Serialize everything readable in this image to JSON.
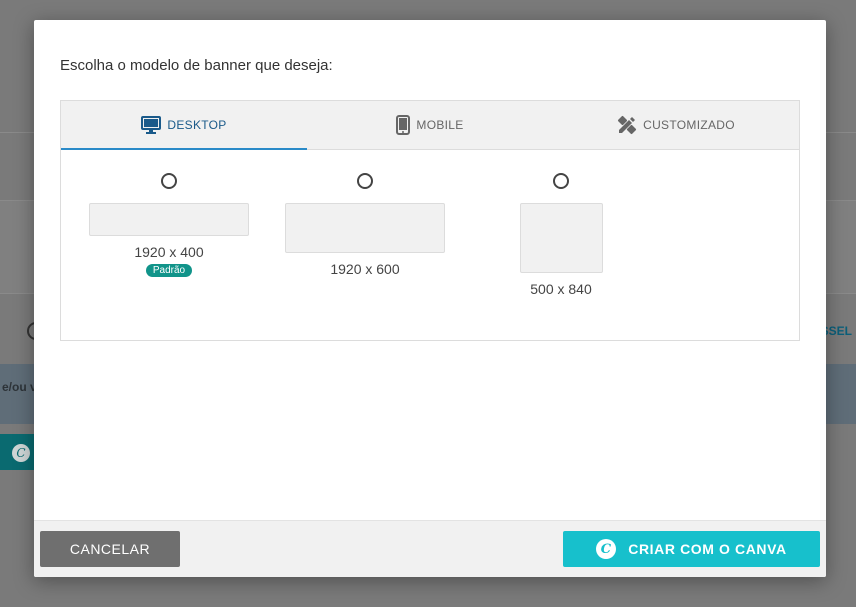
{
  "background": {
    "info_text": "e/ou v",
    "tab_text": "SSEL",
    "canva_glyph": "C"
  },
  "modal": {
    "prompt": "Escolha o modelo de banner que deseja:",
    "tabs": [
      {
        "label": "DESKTOP",
        "icon": "desktop-icon",
        "active": true
      },
      {
        "label": "MOBILE",
        "icon": "mobile-icon",
        "active": false
      },
      {
        "label": "CUSTOMIZADO",
        "icon": "design-tools-icon",
        "active": false
      }
    ],
    "options": [
      {
        "size": "1920 x 400",
        "badge": "Padrão"
      },
      {
        "size": "1920 x 600"
      },
      {
        "size": "500 x 840"
      }
    ],
    "footer": {
      "cancel_label": "CANCELAR",
      "canva_label": "CRIAR COM O CANVA",
      "canva_glyph": "C"
    }
  },
  "colors": {
    "accent_blue": "#2a8ac8",
    "canva_button": "#17c0cc",
    "badge": "#11948a",
    "cancel_button": "#6f6f6f"
  }
}
